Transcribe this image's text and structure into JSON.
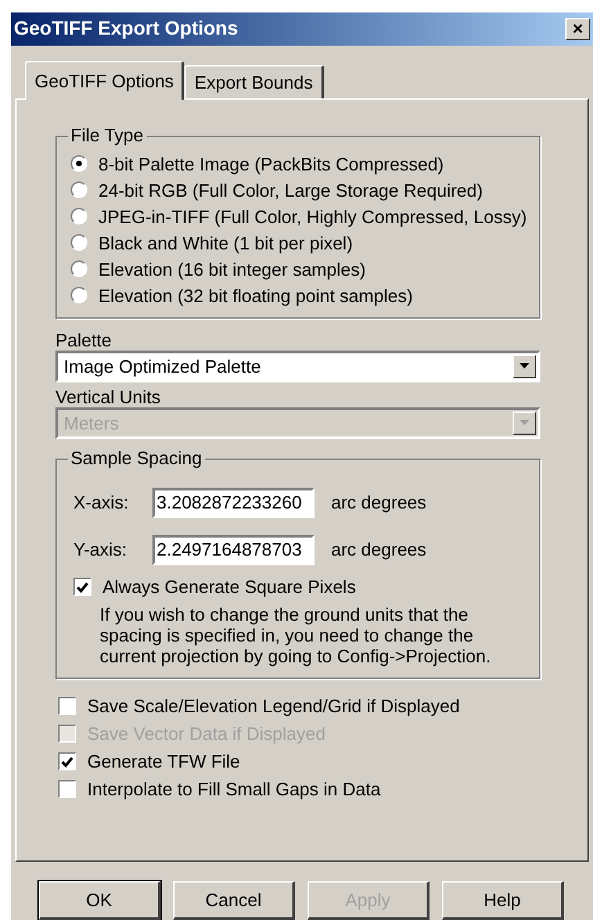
{
  "window": {
    "title": "GeoTIFF Export Options",
    "close": "×"
  },
  "tabs": [
    {
      "label": "GeoTIFF Options",
      "selected": true
    },
    {
      "label": "Export Bounds",
      "selected": false
    }
  ],
  "file_type": {
    "title": "File Type",
    "options": [
      {
        "label": "8-bit Palette Image (PackBits Compressed)",
        "selected": true
      },
      {
        "label": "24-bit RGB (Full Color, Large Storage Required)",
        "selected": false
      },
      {
        "label": "JPEG-in-TIFF (Full Color, Highly Compressed, Lossy)",
        "selected": false
      },
      {
        "label": "Black and White (1 bit per pixel)",
        "selected": false
      },
      {
        "label": "Elevation (16 bit integer samples)",
        "selected": false
      },
      {
        "label": "Elevation (32 bit floating point samples)",
        "selected": false
      }
    ]
  },
  "palette": {
    "label": "Palette",
    "value": "Image Optimized Palette",
    "disabled": false
  },
  "vertical_units": {
    "label": "Vertical Units",
    "value": "Meters",
    "disabled": true
  },
  "sample_spacing": {
    "title": "Sample Spacing",
    "fields": [
      {
        "label": "X-axis:",
        "value": "3.2082872233260",
        "unit": "arc degrees"
      },
      {
        "label": "Y-axis:",
        "value": "2.2497164878703",
        "unit": "arc degrees"
      }
    ],
    "square_pixels": {
      "label": "Always Generate Square Pixels",
      "checked": true,
      "disabled": false
    },
    "note": "If you wish to change the ground units that the spacing is specified in, you need to change the current projection by going to Config->Projection."
  },
  "options": [
    {
      "label": "Save Scale/Elevation Legend/Grid if Displayed",
      "checked": false,
      "disabled": false
    },
    {
      "label": "Save Vector Data if Displayed",
      "checked": false,
      "disabled": true
    },
    {
      "label": "Generate TFW File",
      "checked": true,
      "disabled": false
    },
    {
      "label": "Interpolate to Fill Small Gaps in Data",
      "checked": false,
      "disabled": false
    }
  ],
  "buttons": [
    {
      "label": "OK",
      "disabled": false,
      "default": true
    },
    {
      "label": "Cancel",
      "disabled": false,
      "default": false
    },
    {
      "label": "Apply",
      "disabled": true,
      "default": false
    },
    {
      "label": "Help",
      "disabled": false,
      "default": false
    }
  ]
}
